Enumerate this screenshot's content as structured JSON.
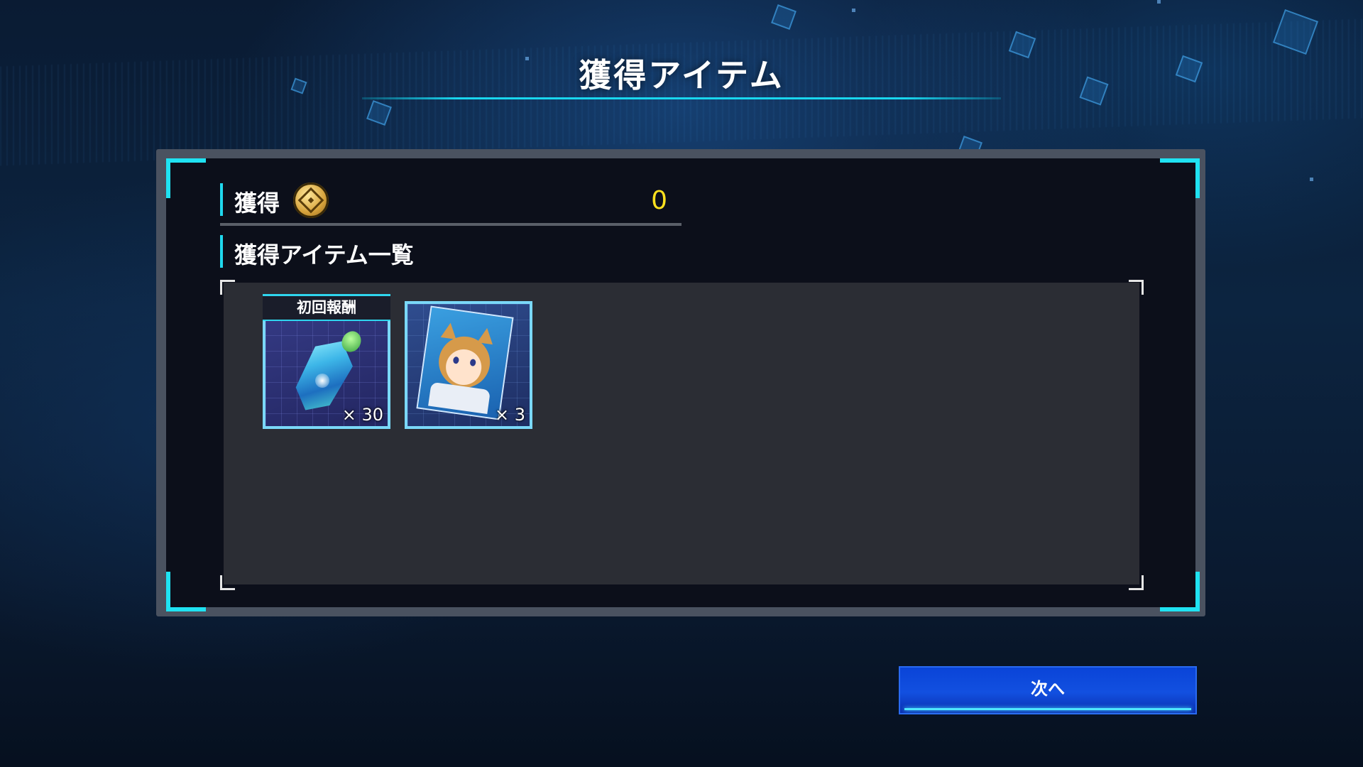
{
  "screen": {
    "title": "獲得アイテム"
  },
  "reward": {
    "label": "獲得",
    "currency_icon": "gold-coin-icon",
    "amount": "0"
  },
  "item_list": {
    "heading": "獲得アイテム一覧",
    "items": [
      {
        "name_icon": "crystal-icon",
        "tag": "初回報酬",
        "quantity": "× 30"
      },
      {
        "name_icon": "character-card-icon",
        "tag": "",
        "quantity": "× 3"
      }
    ]
  },
  "buttons": {
    "next": "次へ"
  },
  "colors": {
    "accent_cyan": "#1fe2f2",
    "amount_yellow": "#ffe11e",
    "button_blue": "#0a44d8"
  }
}
